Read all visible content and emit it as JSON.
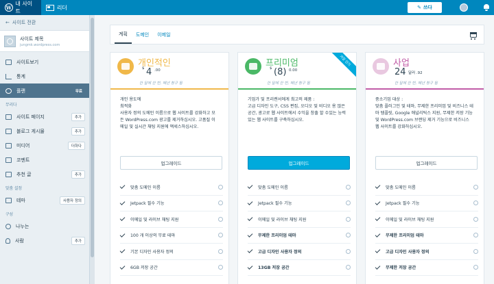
{
  "masterbar": {
    "my_sites": "내 사이트",
    "reader": "리더",
    "write": "쓰다",
    "colors": {
      "bar": "#0087be",
      "active": "#005082"
    }
  },
  "sidebar": {
    "back": "사이트 전환",
    "site_title": "사이트 제목",
    "site_url": "jungmk.wordpress.com",
    "top_items": [
      {
        "label": "사이트보기",
        "icon": "monitor-icon"
      },
      {
        "label": "통계",
        "icon": "chart-icon"
      },
      {
        "label": "플랜",
        "icon": "plan-icon",
        "badge": "무료",
        "active": true
      }
    ],
    "section_manage": "무리다",
    "manage_items": [
      {
        "label": "사이트 페이지",
        "badge": "추가"
      },
      {
        "label": "블로그 게시물",
        "badge": "추가"
      },
      {
        "label": "미디어",
        "badge": "더하다"
      },
      {
        "label": "코멘트"
      },
      {
        "label": "추천 글",
        "badge": "추가"
      }
    ],
    "section_custom": "맞춤 설정",
    "custom_items": [
      {
        "label": "테마",
        "badge": "사용자 정의"
      }
    ],
    "section_config": "구성",
    "config_items": [
      {
        "label": "나누는"
      },
      {
        "label": "사람",
        "badge": "추가"
      }
    ]
  },
  "tabs": [
    "계획",
    "도메인",
    "이메일"
  ],
  "plans": [
    {
      "name": "개인적인",
      "currency": "$",
      "price": "4",
      "cents": ".00",
      "billing": "한 달에 한 번, 매년 청구 됨",
      "color": "#f0b849",
      "desc_title": "개인 용도에",
      "desc_sub": "최적화",
      "desc_body": "사용자 정의 도메인 이름으로 웹 사이트를 강화하고 모든 WordPress.com 광고를 제거하십시오. 고품질 이메일 및 실시간 채팅 지원에 액세스하십시오.",
      "button": "업그레이드",
      "features": [
        {
          "text": "맞춤 도메인 이름",
          "bold": false
        },
        {
          "text": "Jetpack 필수 기능",
          "bold": false
        },
        {
          "text": "이메일 및 라이브 채팅 지원",
          "bold": false
        },
        {
          "text": "100 개 이상의 무료 테마",
          "bold": false
        },
        {
          "text": "기본 디자인 사용자 정의",
          "bold": false
        },
        {
          "text": "6GB 저장 공간",
          "bold": false
        }
      ]
    },
    {
      "name": "프리미엄",
      "currency": "$",
      "price": "(8)",
      "cents": "0.00",
      "billing": "한 달에 한 번, 매년 청구 됨",
      "color": "#4ab866",
      "ribbon": "가장 인기",
      "desc_title": "기업가 및 프리랜서에게 최고의 제품 :",
      "desc_sub": "",
      "desc_body": "고급 디자인 도구, CSS 편집, 오디오 및 비디오 용 많은 공간, 광고로 웹 사이트에서 수익을 창출 할 수있는 능력 있는 웹 사이트를 구축하십시오.",
      "button": "업그레이드",
      "features": [
        {
          "text": "맞춤 도메인 이름",
          "bold": false
        },
        {
          "text": "Jetpack 필수 기능",
          "bold": false
        },
        {
          "text": "이메일 및 라이브 채팅 지원",
          "bold": false
        },
        {
          "text": "무제한 프리미엄 테마",
          "bold": true
        },
        {
          "text": "고급 디자인 사용자 정의",
          "bold": true
        },
        {
          "text": "13GB 저장 공간",
          "bold": true
        }
      ]
    },
    {
      "name": "사업",
      "currency": "",
      "price": "24",
      "cents": "달러 .92",
      "billing": "한 달에 한 번, 매년 청구 됨",
      "color": "#c05ba6",
      "desc_title": "중소기업 대상 :",
      "desc_sub": "",
      "desc_body": "맞춤 플러그인 및 테마, 무제한 프리미엄 및 비즈니스 테마 템플릿, Google 애널리틱스 지원, 무제한 저장 기능 및 WordPress.com 브랜딩 제거 기능으로 비즈니스 웹 사이트를 강화하십시오.",
      "button": "업그레이드",
      "features": [
        {
          "text": "맞춤 도메인 이름",
          "bold": false
        },
        {
          "text": "Jetpack 필수 기능",
          "bold": false
        },
        {
          "text": "이메일 및 라이브 채팅 지원",
          "bold": false
        },
        {
          "text": "무제한 프리미엄 테마",
          "bold": true
        },
        {
          "text": "고급 디자인 사용자 정의",
          "bold": true
        },
        {
          "text": "무제한 저장 공간",
          "bold": true
        }
      ]
    }
  ]
}
